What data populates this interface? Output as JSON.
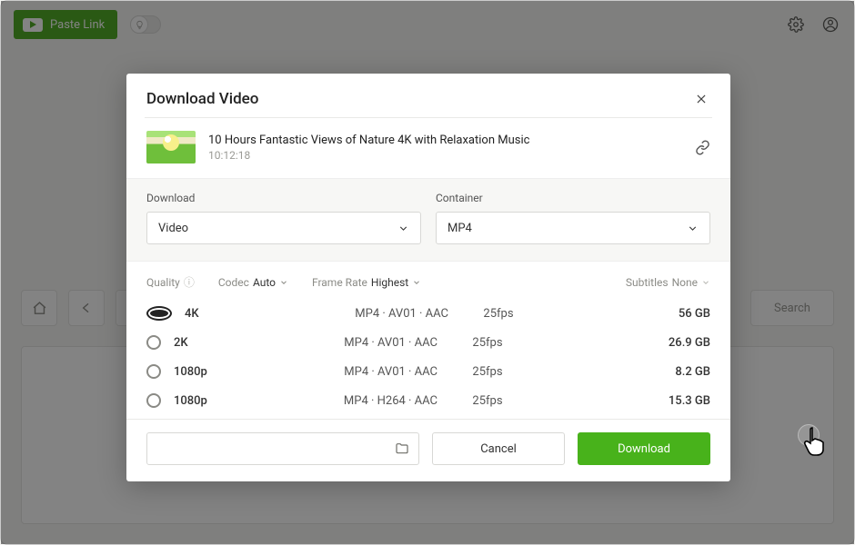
{
  "topbar": {
    "paste_label": "Paste Link"
  },
  "browser": {
    "search_label": "Search"
  },
  "modal": {
    "title": "Download Video",
    "video": {
      "title": "10 Hours Fantastic Views of Nature 4K with Relaxation Music",
      "duration": "10:12:18"
    },
    "labels": {
      "download": "Download",
      "container": "Container"
    },
    "selects": {
      "download": "Video",
      "container": "MP4"
    },
    "filters": {
      "quality_label": "Quality",
      "codec_label": "Codec",
      "codec_value": "Auto",
      "framerate_label": "Frame Rate",
      "framerate_value": "Highest",
      "subtitles_label": "Subtitles",
      "subtitles_value": "None"
    },
    "rows": [
      {
        "quality": "4K",
        "format": "MP4 · AV01 · AAC",
        "fps": "25fps",
        "size": "56 GB",
        "selected": true
      },
      {
        "quality": "2K",
        "format": "MP4 · AV01 · AAC",
        "fps": "25fps",
        "size": "26.9 GB",
        "selected": false
      },
      {
        "quality": "1080p",
        "format": "MP4 · AV01 · AAC",
        "fps": "25fps",
        "size": "8.2 GB",
        "selected": false
      },
      {
        "quality": "1080p",
        "format": "MP4 · H264 · AAC",
        "fps": "25fps",
        "size": "15.3 GB",
        "selected": false
      }
    ],
    "buttons": {
      "cancel": "Cancel",
      "download": "Download"
    }
  }
}
